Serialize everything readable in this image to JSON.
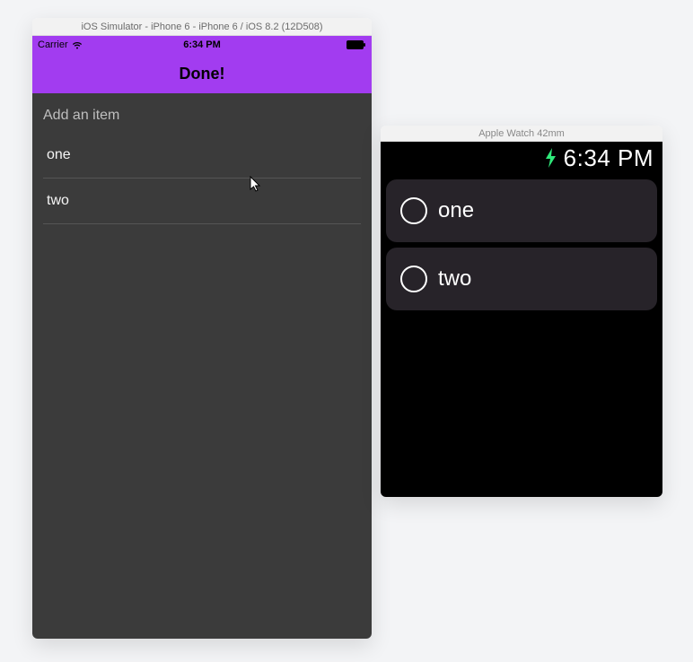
{
  "iphone": {
    "window_title": "iOS Simulator - iPhone 6 - iPhone 6 / iOS 8.2 (12D508)",
    "statusbar": {
      "carrier": "Carrier",
      "time": "6:34 PM"
    },
    "navbar": {
      "title": "Done!"
    },
    "input": {
      "placeholder": "Add an item"
    },
    "items": [
      {
        "label": "one"
      },
      {
        "label": "two"
      }
    ]
  },
  "watch": {
    "window_title": "Apple Watch 42mm",
    "statusbar": {
      "time": "6:34 PM"
    },
    "items": [
      {
        "label": "one"
      },
      {
        "label": "two"
      }
    ]
  },
  "colors": {
    "accent": "#a23cf0",
    "iphone_bg": "#3b3b3b",
    "watch_row": "#272329",
    "bolt": "#2fe97a"
  }
}
